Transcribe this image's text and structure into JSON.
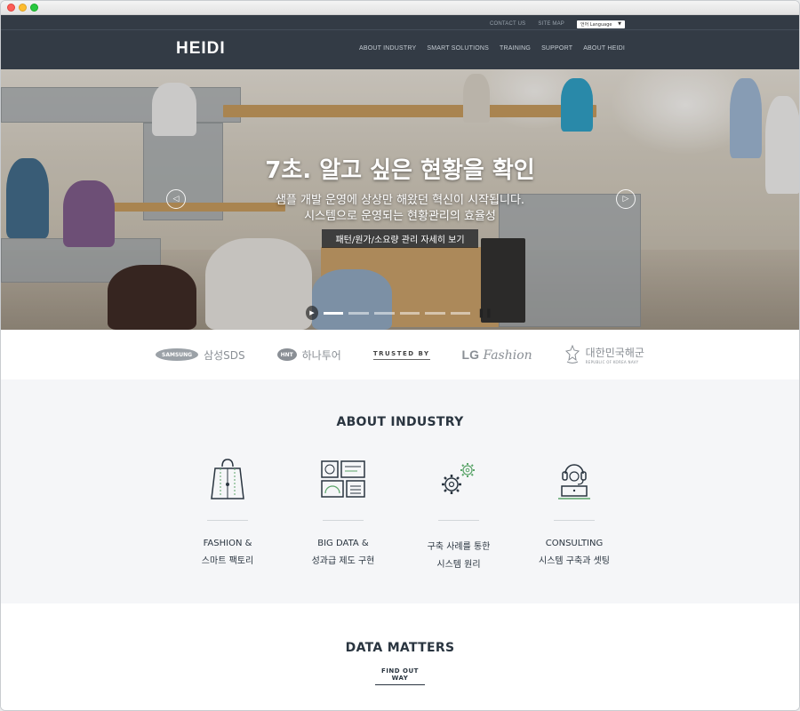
{
  "topbar": {
    "contact": "CONTACT US",
    "sitemap": "SITE MAP",
    "language": "언어 Language"
  },
  "header": {
    "logo": "HEIDI"
  },
  "nav": [
    {
      "label": "ABOUT INDUSTRY"
    },
    {
      "label": "SMART SOLUTIONS"
    },
    {
      "label": "TRAINING"
    },
    {
      "label": "SUPPORT"
    },
    {
      "label": "ABOUT HEIDI"
    }
  ],
  "hero": {
    "title": "7초. 알고 싶은 현황을 확인",
    "subtitle_line1": "샘플 개발 운영에 상상만 해왔던 혁신이 시작됩니다.",
    "subtitle_line2": "시스템으로 운영되는 현황관리의 효율성",
    "button": "패턴/원가/소요량 관리 자세히 보기",
    "slides_total": 6,
    "active_slide": 1
  },
  "partners": {
    "samsung_logo": "SAMSUNG",
    "samsung_text": "삼성SDS",
    "hnt_logo": "HNT",
    "hnt_text": "하나투어",
    "trusted": "TRUSTED BY",
    "lg_mark": "LG",
    "lg_text": "Fashion",
    "navy_kr": "대한민국해군",
    "navy_en": "REPUBLIC OF KOREA NAVY"
  },
  "industry": {
    "title": "ABOUT INDUSTRY",
    "cards": [
      {
        "line1": "FASHION &",
        "line2": "스마트 팩토리",
        "icon": "shopping-bag-icon"
      },
      {
        "line1": "BIG DATA &",
        "line2": "성과급 제도 구현",
        "icon": "dashboard-icon"
      },
      {
        "line1": "구축 사례를 통한",
        "line2": "시스템 원리",
        "icon": "gears-icon"
      },
      {
        "line1": "CONSULTING",
        "line2": "시스템 구축과 셋팅",
        "icon": "headset-icon"
      }
    ]
  },
  "data_matters": {
    "title": "DATA MATTERS",
    "link": "FIND OUT WAY"
  },
  "colors": {
    "header_bg": "#333b45",
    "accent_green": "#5aa469",
    "text_dark": "#2a3540"
  }
}
